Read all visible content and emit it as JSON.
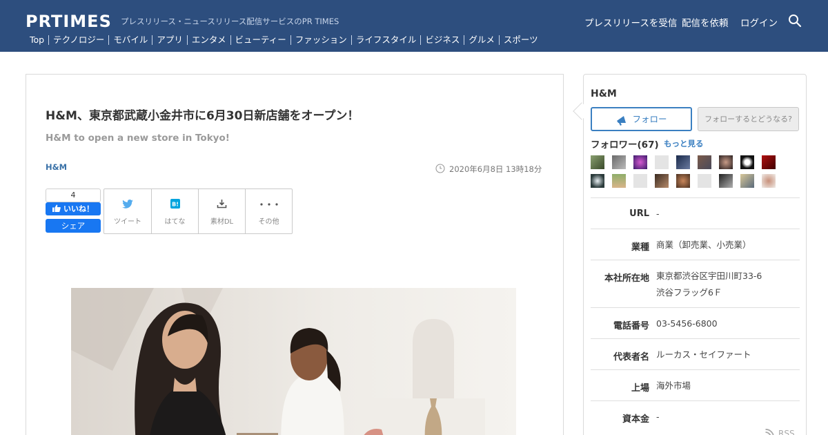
{
  "header": {
    "logo": "PRTIMES",
    "tagline": "プレスリリース・ニュースリリース配信サービスのPR TIMES",
    "nav": [
      "プレスリリースを受信",
      "配信を依頼",
      "ログイン"
    ],
    "search_icon": "search-icon",
    "categories": [
      "Top",
      "テクノロジー",
      "モバイル",
      "アプリ",
      "エンタメ",
      "ビューティー",
      "ファッション",
      "ライフスタイル",
      "ビジネス",
      "グルメ",
      "スポーツ"
    ]
  },
  "article": {
    "title": "H&M、東京都武蔵小金井市に6月30日新店舗をオープン！",
    "subtitle": "H&M to open a new store in Tokyo!",
    "company": "H&M",
    "date": "2020年6月8日 13時18分",
    "like_count": "4",
    "like_label": "いいね！",
    "share_label": "シェア",
    "social": [
      {
        "label": "ツイート",
        "icon": "twitter-icon"
      },
      {
        "label": "はてな",
        "icon": "hatena-icon"
      },
      {
        "label": "素材DL",
        "icon": "download-icon"
      },
      {
        "label": "その他",
        "icon": "more-icon"
      }
    ]
  },
  "sidebar": {
    "company_name": "H&M",
    "follow_label": "フォロー",
    "what_label": "フォローするとどうなる?",
    "followers_label": "フォロワー(67)",
    "more_label": "もっと見る",
    "info": [
      {
        "label": "URL",
        "value": "-"
      },
      {
        "label": "業種",
        "value": "商業（卸売業、小売業）"
      },
      {
        "label": "本社所在地",
        "value": "東京都渋谷区宇田川町33-6",
        "value2": "渋谷フラッグ6Ｆ"
      },
      {
        "label": "電話番号",
        "value": "03-5456-6800"
      },
      {
        "label": "代表者名",
        "value": "ルーカス・セイファート"
      },
      {
        "label": "上場",
        "value": "海外市場"
      },
      {
        "label": "資本金",
        "value": "-"
      }
    ],
    "rss_label": "RSS"
  },
  "colors": {
    "header_bg": "#2d4e7e",
    "facebook_blue": "#1877f2",
    "link_blue": "#3a7fc1"
  }
}
